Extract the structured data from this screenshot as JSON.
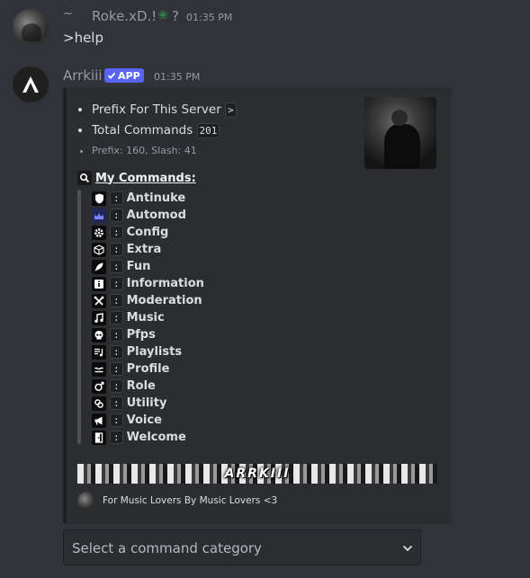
{
  "message1": {
    "reply_indicator": "~",
    "username": "Roke.xD.!",
    "username_suffix": "?",
    "timestamp": "01:35 PM",
    "content": ">help"
  },
  "message2": {
    "username": "Arrkiii",
    "badge": "APP",
    "timestamp": "01:35 PM"
  },
  "embed": {
    "prefix_label": "Prefix For This Server",
    "prefix_value": ">",
    "total_label": "Total Commands",
    "total_value": "201",
    "counts_text": "Prefix: 160, Slash: 41",
    "commands_title": "My Commands:",
    "separator": ":",
    "commands": [
      {
        "name": "Antinuke",
        "icon": "shield-icon"
      },
      {
        "name": "Automod",
        "icon": "automod-icon"
      },
      {
        "name": "Config",
        "icon": "gear-icon"
      },
      {
        "name": "Extra",
        "icon": "cube-icon"
      },
      {
        "name": "Fun",
        "icon": "rocket-icon"
      },
      {
        "name": "Information",
        "icon": "info-icon"
      },
      {
        "name": "Moderation",
        "icon": "tools-icon"
      },
      {
        "name": "Music",
        "icon": "music-note-icon"
      },
      {
        "name": "Pfps",
        "icon": "skull-icon"
      },
      {
        "name": "Playlists",
        "icon": "playlist-icon"
      },
      {
        "name": "Profile",
        "icon": "profile-icon"
      },
      {
        "name": "Role",
        "icon": "role-icon"
      },
      {
        "name": "Utility",
        "icon": "utility-icon"
      },
      {
        "name": "Voice",
        "icon": "megaphone-icon"
      },
      {
        "name": "Welcome",
        "icon": "door-icon"
      }
    ],
    "banner_text": "ARRKIII",
    "footer_text": "For Music Lovers By Music Lovers <3"
  },
  "select_menu": {
    "placeholder": "Select a command category"
  },
  "colors": {
    "background": "#313338",
    "embed_background": "#2b2d31",
    "app_badge": "#5865f2",
    "muted_text": "#949ba4"
  }
}
